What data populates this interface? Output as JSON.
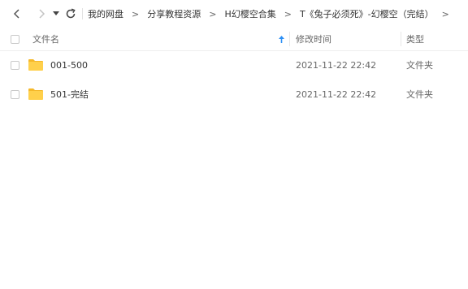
{
  "toolbar": {
    "breadcrumbs": [
      {
        "label": "我的网盘"
      },
      {
        "label": "分享教程资源"
      },
      {
        "label": "H幻樱空合集"
      },
      {
        "label": "T《兔子必须死》-幻樱空（完结）"
      }
    ]
  },
  "columns": {
    "name": "文件名",
    "modified": "修改时间",
    "type": "类型"
  },
  "files": [
    {
      "name": "001-500",
      "modified": "2021-11-22 22:42",
      "type": "文件夹"
    },
    {
      "name": "501-完结",
      "modified": "2021-11-22 22:42",
      "type": "文件夹"
    }
  ],
  "colors": {
    "folder": "#ffd04b",
    "folder_tab": "#f5b829",
    "accent": "#2b8ff5"
  }
}
